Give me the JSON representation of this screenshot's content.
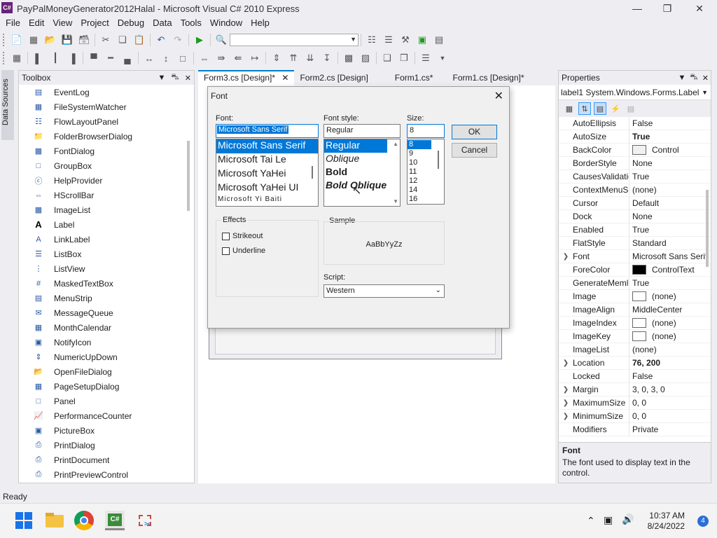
{
  "window": {
    "app_icon": "C#",
    "title": "PayPalMoneyGenerator2012Halal - Microsoft Visual C# 2010 Express",
    "controls": [
      "minimize-icon",
      "restore-icon",
      "close-icon"
    ]
  },
  "menu": [
    "File",
    "Edit",
    "View",
    "Project",
    "Debug",
    "Data",
    "Tools",
    "Window",
    "Help"
  ],
  "sidebar_strip": {
    "label": "Data Sources"
  },
  "toolbox": {
    "title": "Toolbox",
    "items": [
      {
        "label": "EventLog",
        "icon": "eventlog-icon"
      },
      {
        "label": "FileSystemWatcher",
        "icon": "filesystemwatcher-icon"
      },
      {
        "label": "FlowLayoutPanel",
        "icon": "flowlayoutpanel-icon"
      },
      {
        "label": "FolderBrowserDialog",
        "icon": "folderbrowser-icon"
      },
      {
        "label": "FontDialog",
        "icon": "fontdialog-icon"
      },
      {
        "label": "GroupBox",
        "icon": "groupbox-icon"
      },
      {
        "label": "HelpProvider",
        "icon": "helpprovider-icon"
      },
      {
        "label": "HScrollBar",
        "icon": "hscrollbar-icon"
      },
      {
        "label": "ImageList",
        "icon": "imagelist-icon"
      },
      {
        "label": "Label",
        "icon": "label-icon"
      },
      {
        "label": "LinkLabel",
        "icon": "linklabel-icon"
      },
      {
        "label": "ListBox",
        "icon": "listbox-icon"
      },
      {
        "label": "ListView",
        "icon": "listview-icon"
      },
      {
        "label": "MaskedTextBox",
        "icon": "maskedtextbox-icon"
      },
      {
        "label": "MenuStrip",
        "icon": "menustrip-icon"
      },
      {
        "label": "MessageQueue",
        "icon": "messagequeue-icon"
      },
      {
        "label": "MonthCalendar",
        "icon": "monthcalendar-icon"
      },
      {
        "label": "NotifyIcon",
        "icon": "notifyicon-icon"
      },
      {
        "label": "NumericUpDown",
        "icon": "numericupdown-icon"
      },
      {
        "label": "OpenFileDialog",
        "icon": "openfiledialog-icon"
      },
      {
        "label": "PageSetupDialog",
        "icon": "pagesetupdialog-icon"
      },
      {
        "label": "Panel",
        "icon": "panel-icon"
      },
      {
        "label": "PerformanceCounter",
        "icon": "performancecounter-icon"
      },
      {
        "label": "PictureBox",
        "icon": "picturebox-icon"
      },
      {
        "label": "PrintDialog",
        "icon": "printdialog-icon"
      },
      {
        "label": "PrintDocument",
        "icon": "printdocument-icon"
      },
      {
        "label": "PrintPreviewControl",
        "icon": "printpreviewcontrol-icon"
      }
    ]
  },
  "tabs": [
    {
      "label": "Form3.cs [Design]*",
      "active": true
    },
    {
      "label": "Form2.cs [Design]",
      "active": false
    },
    {
      "label": "Form1.cs*",
      "active": false
    },
    {
      "label": "Form1.cs [Design]*",
      "active": false
    }
  ],
  "font_dialog": {
    "title": "Font",
    "font_label": "Font:",
    "font_value": "Microsoft Sans Serif",
    "fonts": [
      "Microsoft Sans Serif",
      "Microsoft Tai Le",
      "Microsoft YaHei",
      "Microsoft YaHei UI",
      "Microsoft Yi Baiti"
    ],
    "style_label": "Font style:",
    "style_value": "Regular",
    "styles": [
      "Regular",
      "Oblique",
      "Bold",
      "Bold Oblique"
    ],
    "size_label": "Size:",
    "size_value": "8",
    "sizes": [
      "8",
      "9",
      "10",
      "11",
      "12",
      "14",
      "16"
    ],
    "ok": "OK",
    "cancel": "Cancel",
    "effects_label": "Effects",
    "strikeout": "Strikeout",
    "underline": "Underline",
    "sample_label": "Sample",
    "sample_text": "AaBbYyZz",
    "script_label": "Script:",
    "script_value": "Western"
  },
  "properties": {
    "title": "Properties",
    "object": "label1 System.Windows.Forms.Label",
    "rows": [
      {
        "name": "AutoEllipsis",
        "value": "False"
      },
      {
        "name": "AutoSize",
        "value": "True",
        "bold": true
      },
      {
        "name": "BackColor",
        "value": "Control",
        "swatch": "#f0f0f0"
      },
      {
        "name": "BorderStyle",
        "value": "None"
      },
      {
        "name": "CausesValidatio",
        "value": "True"
      },
      {
        "name": "ContextMenuS",
        "value": "(none)"
      },
      {
        "name": "Cursor",
        "value": "Default"
      },
      {
        "name": "Dock",
        "value": "None"
      },
      {
        "name": "Enabled",
        "value": "True"
      },
      {
        "name": "FlatStyle",
        "value": "Standard"
      },
      {
        "name": "Font",
        "value": "Microsoft Sans Serif",
        "expand": true
      },
      {
        "name": "ForeColor",
        "value": "ControlText",
        "swatch": "#000000"
      },
      {
        "name": "GenerateMeml",
        "value": "True"
      },
      {
        "name": "Image",
        "value": "(none)",
        "swatch": "#ffffff"
      },
      {
        "name": "ImageAlign",
        "value": "MiddleCenter"
      },
      {
        "name": "ImageIndex",
        "value": "(none)",
        "swatch": "#ffffff"
      },
      {
        "name": "ImageKey",
        "value": "(none)",
        "swatch": "#ffffff"
      },
      {
        "name": "ImageList",
        "value": "(none)"
      },
      {
        "name": "Location",
        "value": "76, 200",
        "bold": true,
        "expand": true
      },
      {
        "name": "Locked",
        "value": "False"
      },
      {
        "name": "Margin",
        "value": "3, 0, 3, 0",
        "expand": true
      },
      {
        "name": "MaximumSize",
        "value": "0, 0",
        "expand": true
      },
      {
        "name": "MinimumSize",
        "value": "0, 0",
        "expand": true
      },
      {
        "name": "Modifiers",
        "value": "Private"
      }
    ],
    "desc_name": "Font",
    "desc_text": "The font used to display text in the control."
  },
  "status": "Ready",
  "taskbar": {
    "time": "10:37 AM",
    "date": "8/24/2022",
    "notifications": "4"
  }
}
